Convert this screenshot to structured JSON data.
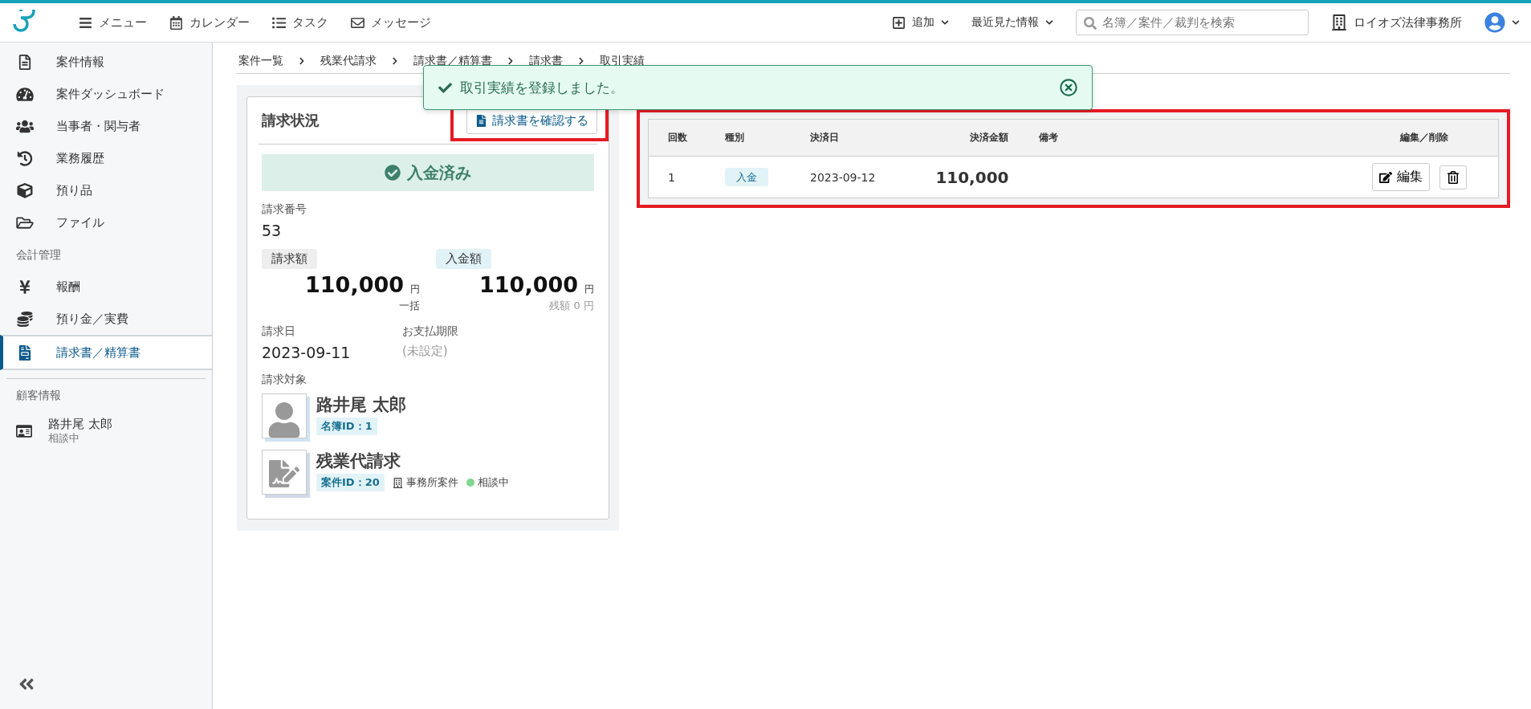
{
  "header": {
    "nav": [
      {
        "label": "メニュー"
      },
      {
        "label": "カレンダー"
      },
      {
        "label": "タスク"
      },
      {
        "label": "メッセージ"
      }
    ],
    "add_button": "追加",
    "recent_button": "最近見た情報",
    "search": {
      "placeholder": "名簿／案件／裁判を検索"
    },
    "office": "ロイオズ法律事務所"
  },
  "sidebar": {
    "items": [
      {
        "kind": "item",
        "label": "案件情報",
        "selected": false
      },
      {
        "kind": "item",
        "label": "案件ダッシュボード",
        "selected": false
      },
      {
        "kind": "item",
        "label": "当事者・関与者",
        "selected": false
      },
      {
        "kind": "item",
        "label": "業務履歴",
        "selected": false
      },
      {
        "kind": "item",
        "label": "預り品",
        "selected": false
      },
      {
        "kind": "item",
        "label": "ファイル",
        "selected": false
      },
      {
        "kind": "section",
        "label": "会計管理"
      },
      {
        "kind": "item",
        "label": "報酬",
        "selected": false
      },
      {
        "kind": "item",
        "label": "預り金／実費",
        "selected": false
      },
      {
        "kind": "item",
        "label": "請求書／精算書",
        "selected": true
      },
      {
        "kind": "section",
        "label": "顧客情報"
      },
      {
        "kind": "client",
        "label": "路井尾 太郎",
        "sub": "相談中"
      }
    ]
  },
  "breadcrumb": [
    "案件一覧",
    "残業代請求",
    "請求書／精算書",
    "請求書",
    "取引実績"
  ],
  "toast": {
    "message": "取引実績を登録しました。"
  },
  "invoice": {
    "title": "請求状況",
    "confirm_button": "請求書を確認する",
    "status": "入金済み",
    "number_label": "請求番号",
    "number": "53",
    "amounts": [
      {
        "kind": "billed",
        "label": "請求額",
        "value": "110,000",
        "unit": "円",
        "note": "一括"
      },
      {
        "kind": "paid",
        "label": "入金額",
        "value": "110,000",
        "unit": "円",
        "note": "残額 0 円"
      }
    ],
    "dates": [
      {
        "label": "請求日",
        "value": "2023-09-11",
        "muted": false
      },
      {
        "label": "お支払期限",
        "value": "(未設定)",
        "muted": true
      }
    ],
    "target_label": "請求対象",
    "targets": [
      {
        "kind": "person",
        "name": "路井尾 太郎",
        "id": "名簿ID：1"
      },
      {
        "kind": "case",
        "name": "残業代請求",
        "id": "案件ID：20",
        "office": "事務所案件",
        "status": "相談中",
        "color": "#7fd88f"
      }
    ]
  },
  "transactions": {
    "columns": [
      "回数",
      "種別",
      "決済日",
      "決済金額",
      "備考",
      "編集／削除"
    ],
    "rows": [
      {
        "count": "1",
        "type": "入金",
        "date": "2023-09-12",
        "amount": "110,000",
        "edit": "編集"
      }
    ]
  }
}
